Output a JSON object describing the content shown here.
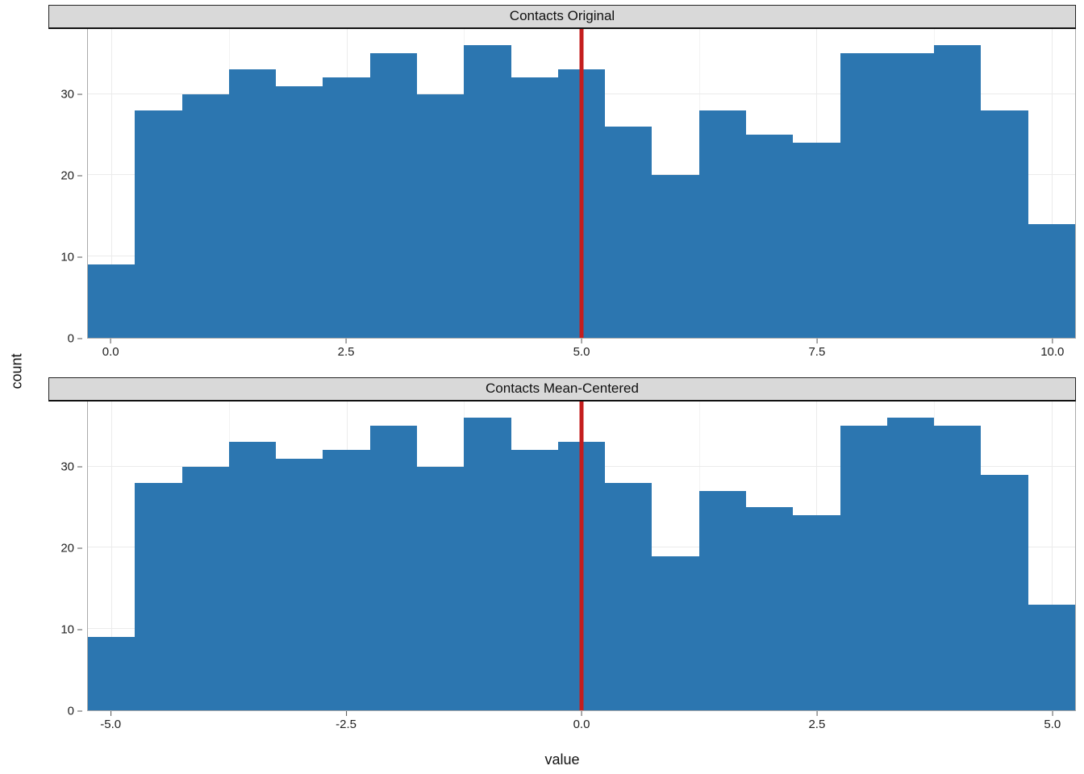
{
  "ylabel": "count",
  "xlabel": "value",
  "chart_data": [
    {
      "type": "bar",
      "facet_label": "Contacts Original",
      "xmin": -0.25,
      "xmax": 10.25,
      "xticks": [
        0.0,
        2.5,
        5.0,
        7.5,
        10.0
      ],
      "xtick_labels": [
        "0.0",
        "2.5",
        "5.0",
        "7.5",
        "10.0"
      ],
      "ymin": 0,
      "ymax": 38,
      "yticks": [
        0,
        10,
        20,
        30
      ],
      "vline": 5.0,
      "bar_color": "#2c76b0",
      "vline_color": "#c41e1e",
      "bin_width": 0.5,
      "categories": [
        "-0.25–0.25",
        "0.25–0.75",
        "0.75–1.25",
        "1.25–1.75",
        "1.75–2.25",
        "2.25–2.75",
        "2.75–3.25",
        "3.25–3.75",
        "3.75–4.25",
        "4.25–4.75",
        "4.75–5.25",
        "5.25–5.75",
        "5.75–6.25",
        "6.25–6.75",
        "6.75–7.25",
        "7.25–7.75",
        "7.75–8.25",
        "8.25–8.75",
        "8.75–9.25",
        "9.25–9.75",
        "9.75–10.25"
      ],
      "values": [
        9,
        28,
        30,
        33,
        31,
        32,
        35,
        30,
        36,
        32,
        33,
        26,
        20,
        28,
        25,
        24,
        35,
        35,
        36,
        28,
        14
      ]
    },
    {
      "type": "bar",
      "facet_label": "Contacts Mean-Centered",
      "xmin": -5.25,
      "xmax": 5.25,
      "xticks": [
        -5.0,
        -2.5,
        0.0,
        2.5,
        5.0
      ],
      "xtick_labels": [
        "-5.0",
        "-2.5",
        "0.0",
        "2.5",
        "5.0"
      ],
      "ymin": 0,
      "ymax": 38,
      "yticks": [
        0,
        10,
        20,
        30
      ],
      "vline": 0.0,
      "bar_color": "#2c76b0",
      "vline_color": "#c41e1e",
      "bin_width": 0.5,
      "categories": [
        "-5.25–-4.75",
        "-4.75–-4.25",
        "-4.25–-3.75",
        "-3.75–-3.25",
        "-3.25–-2.75",
        "-2.75–-2.25",
        "-2.25–-1.75",
        "-1.75–-1.25",
        "-1.25–-0.75",
        "-0.75–-0.25",
        "-0.25–0.25",
        "0.25–0.75",
        "0.75–1.25",
        "1.25–1.75",
        "1.75–2.25",
        "2.25–2.75",
        "2.75–3.25",
        "3.25–3.75",
        "3.75–4.25",
        "4.25–4.75",
        "4.75–5.25"
      ],
      "values": [
        9,
        28,
        30,
        33,
        31,
        32,
        35,
        30,
        36,
        32,
        33,
        28,
        19,
        27,
        25,
        24,
        35,
        36,
        35,
        29,
        13
      ]
    }
  ]
}
